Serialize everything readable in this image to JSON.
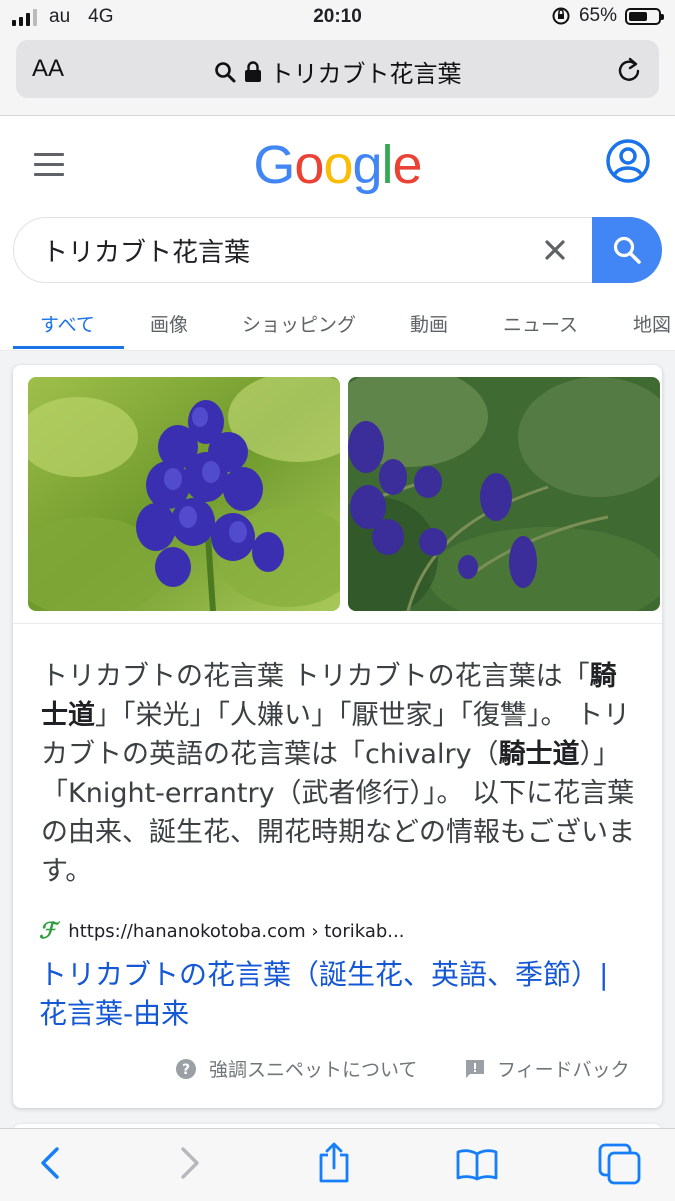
{
  "status": {
    "carrier": "au",
    "network": "4G",
    "time": "20:10",
    "battery_text": "65%",
    "battery_level": 0.65
  },
  "browser": {
    "text_size_label": "AA",
    "url_text": "トリカブト花言葉"
  },
  "google": {
    "logo_letters": [
      {
        "ch": "G",
        "color": "#4285f4"
      },
      {
        "ch": "o",
        "color": "#ea4335"
      },
      {
        "ch": "o",
        "color": "#fbbc05"
      },
      {
        "ch": "g",
        "color": "#4285f4"
      },
      {
        "ch": "l",
        "color": "#34a853"
      },
      {
        "ch": "e",
        "color": "#ea4335"
      }
    ],
    "query": "トリカブト花言葉",
    "tabs": [
      "すべて",
      "画像",
      "ショッピング",
      "動画",
      "ニュース",
      "地図"
    ],
    "active_tab": "すべて"
  },
  "featured": {
    "images": [
      "monkshood-flower-closeup",
      "monkshood-flowers-garden"
    ],
    "snippet_segments": [
      {
        "text": "トリカブトの花言葉 トリカブトの花言葉は",
        "bold": false
      },
      {
        "text": "「",
        "bold": false
      },
      {
        "text": "騎士道",
        "bold": true
      },
      {
        "text": "」「栄光」「人嫌い」「厭世家」「復讐」。 トリカブトの英語の花言葉は「chivalry（",
        "bold": false
      },
      {
        "text": "騎士道",
        "bold": true
      },
      {
        "text": "）」「Knight-errantry（武者修行）」。 以下に花言葉の由来、誕生花、開花時期などの情報もございます。",
        "bold": false
      }
    ],
    "source_url": "https://hananokotoba.com › torikab...",
    "title": "トリカブトの花言葉（誕生花、英語、季節）| 花言葉-由来",
    "about_label": "強調スニペットについて",
    "feedback_label": "フィードバック"
  },
  "colors": {
    "google_blue": "#4285f4",
    "link_blue": "#1558d6",
    "tab_active": "#1a73e8",
    "safari_blue": "#147efb"
  }
}
